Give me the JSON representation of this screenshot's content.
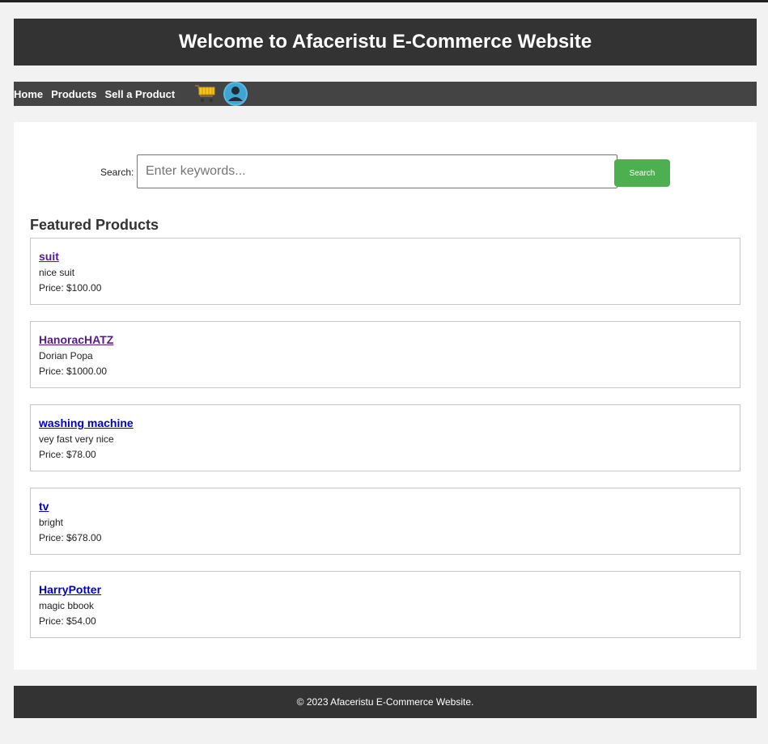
{
  "header": {
    "title": "Welcome to Afaceristu E-Commerce Website"
  },
  "nav": {
    "links": [
      "Home",
      "Products",
      "Sell a Product"
    ],
    "cart_icon": "shopping-cart-icon",
    "avatar_icon": "user-avatar-icon"
  },
  "search": {
    "label": "Search:",
    "placeholder": "Enter keywords...",
    "value": "",
    "button_label": "Search"
  },
  "featured": {
    "title": "Featured Products",
    "products": [
      {
        "name": "suit",
        "description": "nice suit",
        "price": "Price: $100.00",
        "visited": true
      },
      {
        "name": "HanoracHATZ",
        "description": "Dorian Popa",
        "price": "Price: $1000.00",
        "visited": true
      },
      {
        "name": "washing machine",
        "description": "vey fast very nice",
        "price": "Price: $78.00",
        "visited": false
      },
      {
        "name": "tv",
        "description": "bright",
        "price": "Price: $678.00",
        "visited": false
      },
      {
        "name": "HarryPotter",
        "description": "magic bbook",
        "price": "Price: $54.00",
        "visited": false
      }
    ]
  },
  "footer": {
    "text": "© 2023 Afaceristu E-Commerce Website."
  },
  "colors": {
    "header_bg": "#333333",
    "nav_bg": "#444444",
    "search_button": "#4caf50",
    "link_visited": "#551a8b",
    "link_unvisited": "#0000cc"
  }
}
